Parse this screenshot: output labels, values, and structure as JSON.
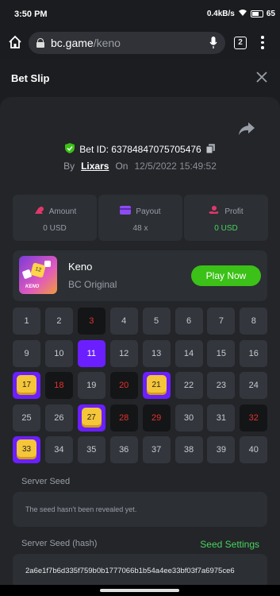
{
  "status_bar": {
    "time": "3:50 PM",
    "speed": "0.4kB/s",
    "battery": "65"
  },
  "browser": {
    "domain": "bc.game",
    "path": "/keno",
    "tab_count": "2"
  },
  "header": {
    "title": "Bet Slip"
  },
  "bet": {
    "id_label": "Bet ID: 63784847075705476",
    "by_label": "By",
    "user": "Lixars",
    "on_label": "On",
    "date": "12/5/2022 15:49:52"
  },
  "stats": {
    "amount": {
      "label": "Amount",
      "value": "0 USD"
    },
    "payout": {
      "label": "Payout",
      "value": "48 x"
    },
    "profit": {
      "label": "Profit",
      "value": "0 USD"
    }
  },
  "game": {
    "name": "Keno",
    "provider": "BC Original",
    "play_label": "Play Now",
    "thumb_text": "KENO",
    "thumb_num": "12"
  },
  "grid": {
    "numbers": [
      1,
      2,
      3,
      4,
      5,
      6,
      7,
      8,
      9,
      10,
      11,
      12,
      13,
      14,
      15,
      16,
      17,
      18,
      19,
      20,
      21,
      22,
      23,
      24,
      25,
      26,
      27,
      28,
      29,
      30,
      31,
      32,
      33,
      34,
      35,
      36,
      37,
      38,
      39,
      40
    ],
    "selected_only": [
      11
    ],
    "hits": [
      17,
      21,
      27,
      33
    ],
    "drawn_missed": [
      3,
      18,
      20,
      28,
      29,
      32
    ]
  },
  "seeds": {
    "server_seed_label": "Server Seed",
    "server_seed_value": "The seed hasn't been revealed yet.",
    "hash_label": "Server Seed (hash)",
    "settings_label": "Seed Settings",
    "hash_value": "2a6e1f7b6d335f759b0b1777066b1b54a4ee33bf03f7a6975ce6"
  },
  "colors": {
    "accent_green": "#3bc117",
    "select_purple": "#6b1fff",
    "miss_red": "#e0332c",
    "hit_gold": "#f5c53a"
  }
}
